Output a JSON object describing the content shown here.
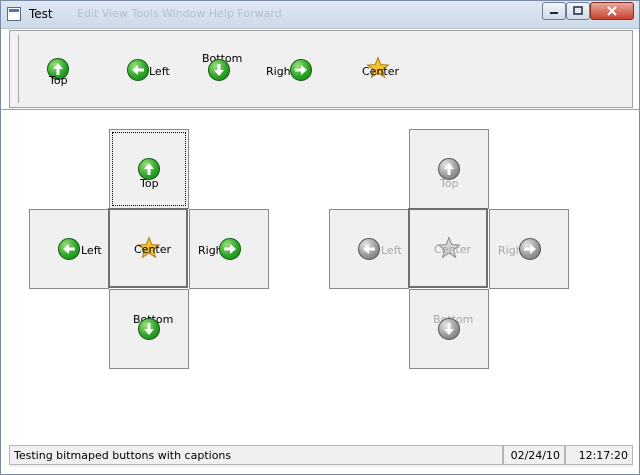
{
  "window": {
    "title": "Test",
    "ghost_text": "Edit View Tools Window Help                       Forward"
  },
  "toolbar": {
    "top": "Top",
    "left": "Left",
    "bottom": "Bottom",
    "right": "Right",
    "center": "Center"
  },
  "pad_enabled": {
    "top": "Top",
    "left": "Left",
    "center": "Center",
    "right": "Right",
    "bottom": "Bottom"
  },
  "pad_disabled": {
    "top": "Top",
    "left": "Left",
    "center": "Center",
    "right": "Right",
    "bottom": "Bottom"
  },
  "status": {
    "message": "Testing bitmaped buttons with captions",
    "date": "02/24/10",
    "time": "12:17:20"
  },
  "icons": {
    "up": "arrow-up-icon",
    "left": "arrow-left-icon",
    "down": "arrow-down-icon",
    "right": "arrow-right-icon",
    "center": "star-icon"
  },
  "colors": {
    "enabled": "#2ea42a",
    "disabled": "#9a9a9a",
    "star": "#f2c230"
  }
}
